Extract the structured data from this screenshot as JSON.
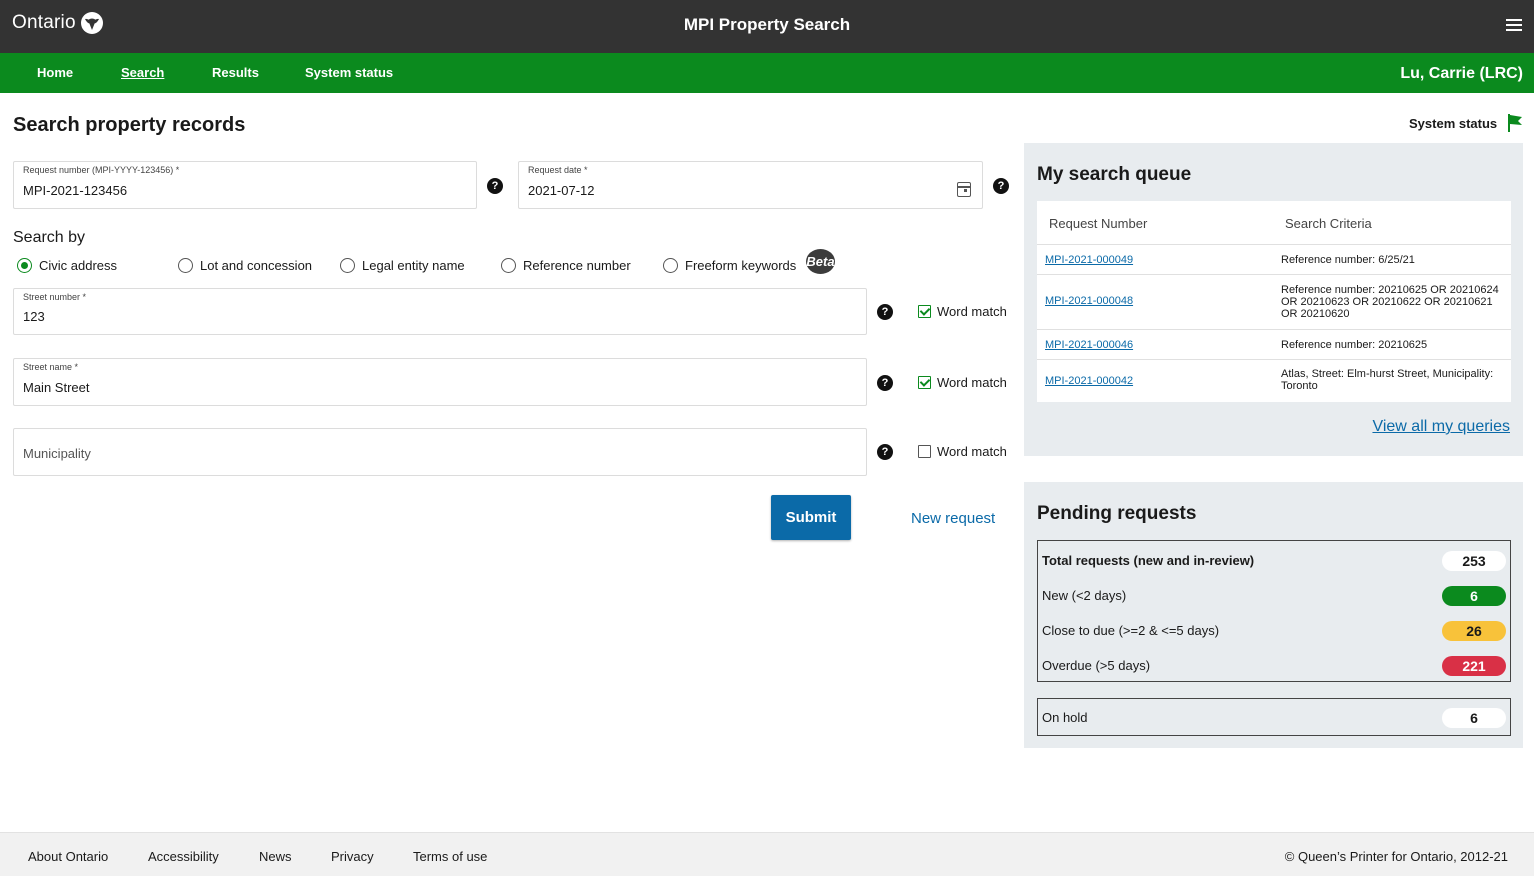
{
  "header": {
    "logo_text": "Ontario",
    "app_title": "MPI Property Search"
  },
  "nav": {
    "items": [
      "Home",
      "Search",
      "Results",
      "System status"
    ],
    "active": "Search",
    "user": "Lu, Carrie (LRC)"
  },
  "page": {
    "title": "Search property records",
    "system_status_label": "System status",
    "system_status_color": "#0b8a1e"
  },
  "form": {
    "request_number": {
      "label": "Request number (MPI-YYYY-123456) *",
      "value": "MPI-2021-123456"
    },
    "request_date": {
      "label": "Request date *",
      "value": "2021-07-12"
    },
    "search_by_label": "Search by",
    "search_options": [
      "Civic address",
      "Lot and concession",
      "Legal entity name",
      "Reference number",
      "Freeform keywords"
    ],
    "selected_option": "Civic address",
    "beta_badge": "Beta",
    "street_number": {
      "label": "Street number *",
      "value": "123",
      "word_match": true
    },
    "street_name": {
      "label": "Street name *",
      "value": "Main Street",
      "word_match": true
    },
    "municipality": {
      "placeholder": "Municipality",
      "word_match": false
    },
    "word_match_label": "Word match",
    "help_glyph": "?",
    "submit_label": "Submit",
    "new_request_label": "New request"
  },
  "queue": {
    "title": "My search queue",
    "columns": [
      "Request Number",
      "Search Criteria"
    ],
    "rows": [
      {
        "request": "MPI-2021-000049",
        "criteria": "Reference number: 6/25/21"
      },
      {
        "request": "MPI-2021-000048",
        "criteria": "Reference number: 20210625 OR 20210624 OR 20210623 OR 20210622 OR 20210621 OR 20210620"
      },
      {
        "request": "MPI-2021-000046",
        "criteria": "Reference number: 20210625"
      },
      {
        "request": "MPI-2021-000042",
        "criteria": "Atlas, Street: Elm-hurst Street, Municipality: Toronto"
      }
    ],
    "view_all_label": "View all my queries"
  },
  "pending": {
    "title": "Pending requests",
    "rows": [
      {
        "label": "Total requests (new and in-review)",
        "count": "253",
        "color": "#ffffff",
        "text_color": "#1a1a1a",
        "bold": true
      },
      {
        "label": "New (<2 days)",
        "count": "6",
        "color": "#0b8a1e",
        "text_color": "#ffffff",
        "bold": false
      },
      {
        "label": "Close to due (>=2 & <=5 days)",
        "count": "26",
        "color": "#f8c23a",
        "text_color": "#1a1a1a",
        "bold": false
      },
      {
        "label": "Overdue (>5 days)",
        "count": "221",
        "color": "#d93046",
        "text_color": "#ffffff",
        "bold": false
      }
    ],
    "on_hold": {
      "label": "On hold",
      "count": "6"
    }
  },
  "footer": {
    "links": [
      "About Ontario",
      "Accessibility",
      "News",
      "Privacy",
      "Terms of use"
    ],
    "copyright": "© Queen’s Printer for Ontario, 2012-21"
  }
}
